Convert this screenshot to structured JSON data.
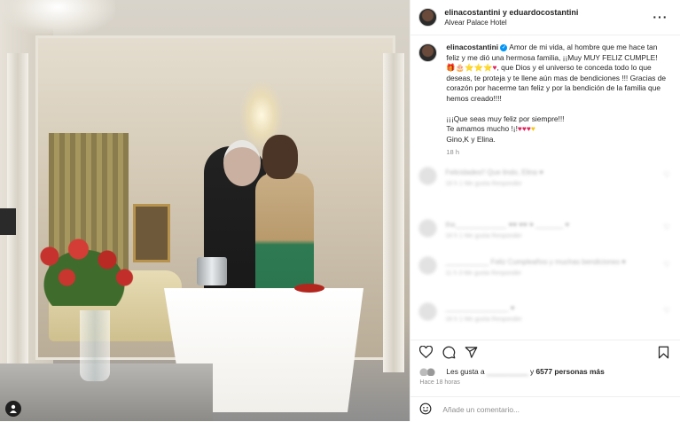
{
  "header": {
    "users": "elinacostantini y eduardocostantini",
    "location": "Alvear Palace Hotel",
    "more_icon": "more-horizontal-icon"
  },
  "caption": {
    "username": "elinacostantini",
    "verified": "✓",
    "text1": "Amor de mi vida, al hombre que me hace tan feliz y me dió una hermosa familia, ¡¡Muy MUY FELIZ CUMPLE!",
    "emojis": "🎁🎂⭐⭐⭐",
    "heart": "♥",
    "text2": ", que Dios y el universo te conceda todo lo que deseas, te proteja y te llene aún mas de bendiciones !!! Gracias de corazón por hacerme tan feliz y por la bendición de la familia que hemos creado!!!!",
    "line_wish": "¡¡¡Que seas muy feliz por siempre!!!",
    "line_love": "Te amamos mucho !¡!",
    "love_hearts": "♥♥♥",
    "love_heart_yellow": "♥",
    "signature": "Gino,K y Elina.",
    "time": "18 h"
  },
  "comments": [
    {
      "text": "Felicidades!! Que lindo, Elina ♥",
      "sub": "18 h   1 Me gusta   Responder"
    },
    {
      "text": "the_____________ ♥♥ ♥♥ ♥ _______ ♥",
      "sub": "18 h   1 Me gusta   Responder"
    },
    {
      "text": "___________ Feliz Cumpleaños y muchas bendiciones ♥",
      "sub": "11 h   3 Me gusta   Responder"
    },
    {
      "text": "________________ ♥",
      "sub": "18 h   1 Me gusta   Responder"
    }
  ],
  "likes": {
    "prefix": "Les gusta a",
    "blurred_user": "__________",
    "middle": "y",
    "count": "6577 personas más"
  },
  "posted": "Hace 18 horas",
  "add_comment": {
    "placeholder": "Añade un comentario..."
  },
  "icons": {
    "heart": "heart-icon",
    "comment": "comment-icon",
    "share": "send-icon",
    "save": "bookmark-icon",
    "emoji": "emoji-icon",
    "person": "person-icon"
  },
  "colors": {
    "verified": "#0095f6",
    "red_heart": "#e0245e",
    "yellow_heart": "#f5c518",
    "muted_text": "#8e8e8e"
  }
}
